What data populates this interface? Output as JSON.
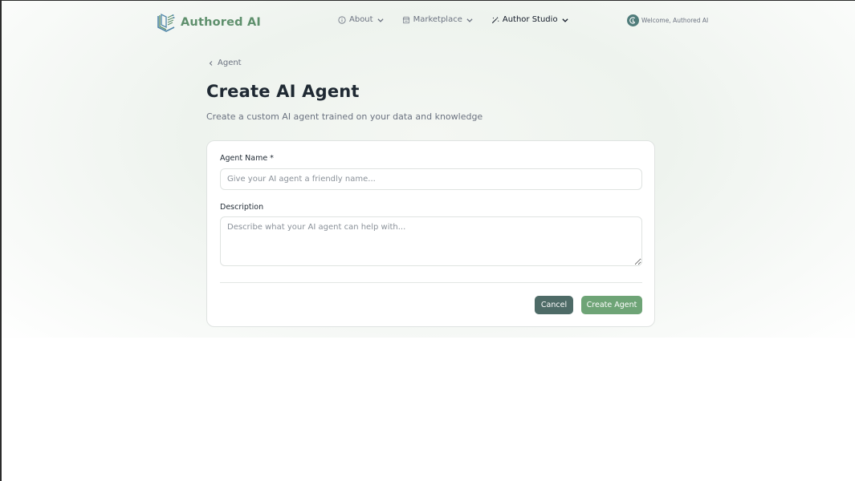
{
  "brand": {
    "name": "Authored AI"
  },
  "nav": {
    "items": [
      {
        "label": "About",
        "icon": "info-icon"
      },
      {
        "label": "Marketplace",
        "icon": "store-icon"
      },
      {
        "label": "Author Studio",
        "icon": "magic-wand-icon"
      }
    ]
  },
  "user": {
    "welcome": "Welcome, Authored AI"
  },
  "breadcrumb": {
    "label": "Agent"
  },
  "page": {
    "title": "Create AI Agent",
    "subtitle": "Create a custom AI agent trained on your data and knowledge"
  },
  "form": {
    "name_label": "Agent Name *",
    "name_placeholder": "Give your AI agent a friendly name...",
    "name_value": "",
    "description_label": "Description",
    "description_placeholder": "Describe what your AI agent can help with...",
    "description_value": "",
    "cancel_label": "Cancel",
    "submit_label": "Create Agent"
  },
  "colors": {
    "brand": "#5e8f6c",
    "cancel_button": "#4e6b67",
    "create_button": "#6ea476",
    "avatar": "#4f7c7a"
  }
}
